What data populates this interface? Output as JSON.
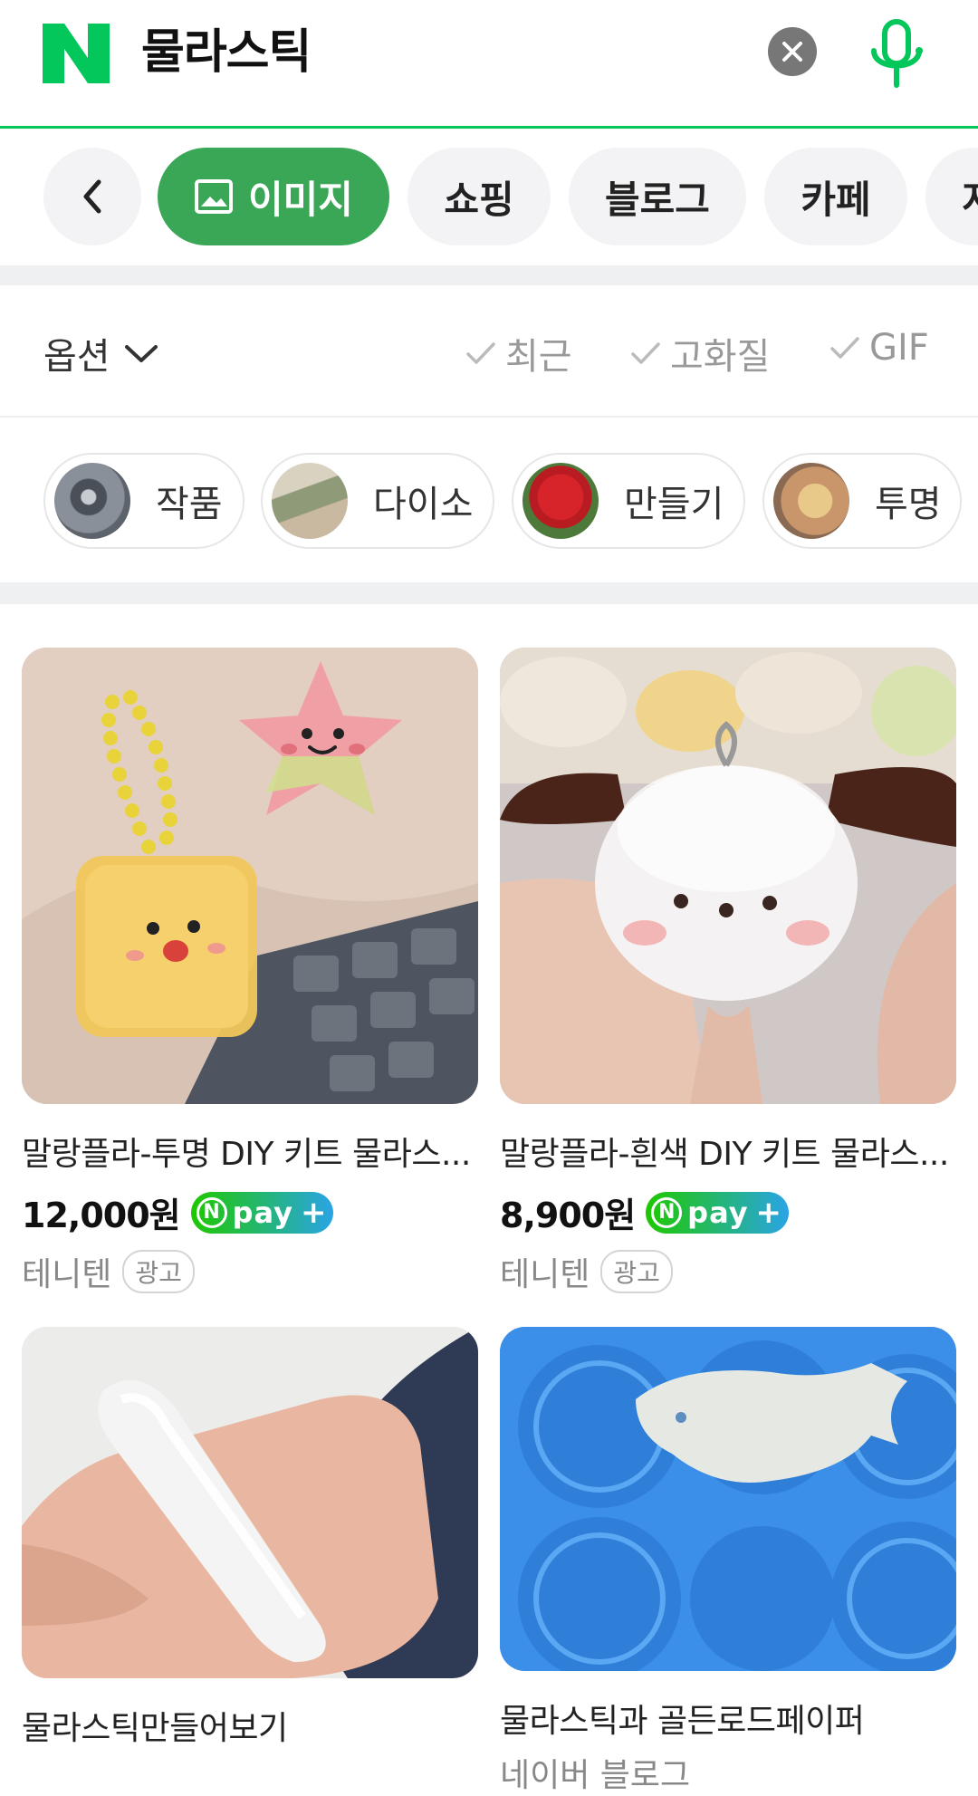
{
  "header": {
    "query": "물라스틱"
  },
  "tabs": [
    {
      "label": "이미지",
      "active": true
    },
    {
      "label": "쇼핑"
    },
    {
      "label": "블로그"
    },
    {
      "label": "카페"
    },
    {
      "label": "지"
    }
  ],
  "options": {
    "label": "옵션",
    "filters": [
      "최근",
      "고화질",
      "GIF"
    ]
  },
  "related": [
    {
      "label": "작품"
    },
    {
      "label": "다이소"
    },
    {
      "label": "만들기"
    },
    {
      "label": "투명"
    }
  ],
  "results": [
    {
      "title": "말랑플라-투명 DIY 키트 물라스...",
      "price": "12,000원",
      "pay_badge": "pay",
      "seller": "테니텐",
      "ad": "광고"
    },
    {
      "title": "말랑플라-흰색 DIY 키트 물라스...",
      "price": "8,900원",
      "pay_badge": "pay",
      "seller": "테니텐",
      "ad": "광고"
    },
    {
      "title": "물라스틱만들어보기"
    },
    {
      "title": "물라스틱과 골든로드페이퍼",
      "source": "네이버 블로그"
    }
  ],
  "colors": {
    "brand_green": "#03c75a",
    "active_tab": "#3aa757",
    "muted_text": "#888888"
  }
}
